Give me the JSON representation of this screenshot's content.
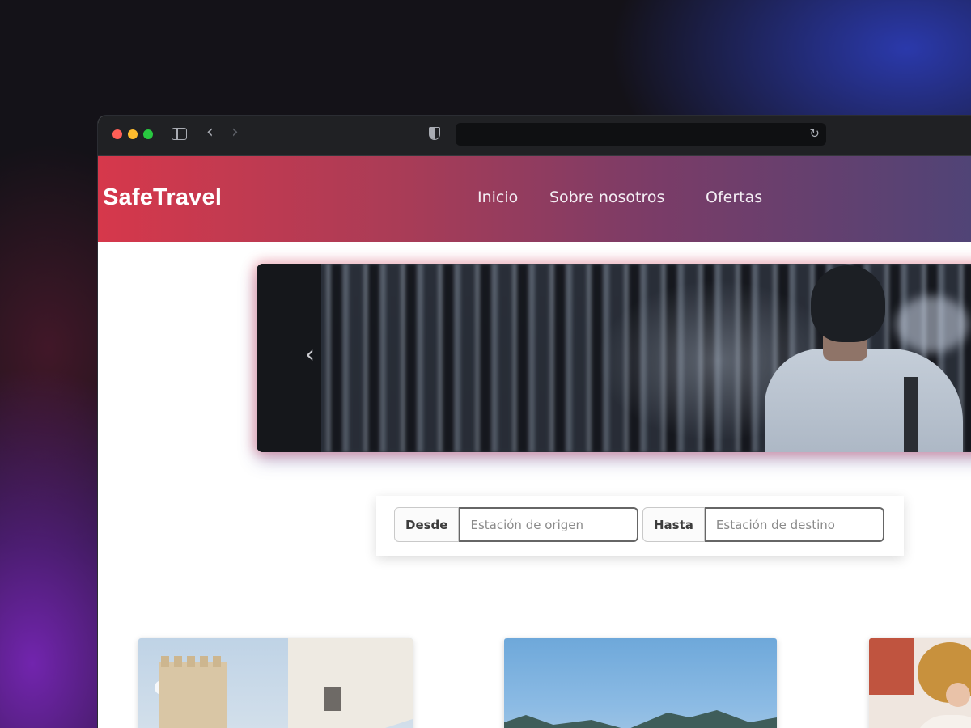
{
  "brand": {
    "name": "SafeTravel",
    "accent_start": "#d6384b",
    "accent_end": "#4e4477"
  },
  "nav": {
    "items": [
      {
        "label": "Inicio"
      },
      {
        "label": "Sobre nosotros"
      },
      {
        "label": "Ofertas"
      }
    ]
  },
  "browser": {
    "icons": {
      "sidebar": "sidebar-icon",
      "back": "chevron-left-icon",
      "forward": "chevron-right-icon",
      "privacy": "shield-icon",
      "reload": "reload-icon"
    },
    "address": ""
  },
  "carousel": {
    "prev_glyph": "‹",
    "next_glyph": "›"
  },
  "search": {
    "from": {
      "label": "Desde",
      "placeholder": "Estación de origen"
    },
    "to": {
      "label": "Hasta",
      "placeholder": "Estación de destino"
    }
  }
}
